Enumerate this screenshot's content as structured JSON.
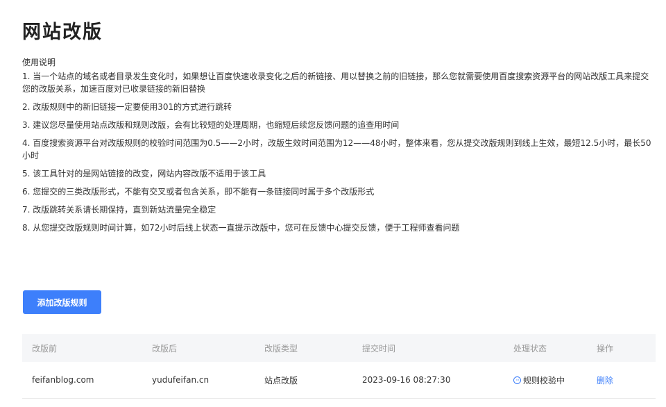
{
  "page": {
    "title": "网站改版"
  },
  "usage": {
    "title": "使用说明",
    "lines": [
      "1. 当一个站点的域名或者目录发生变化时，如果想让百度快速收录变化之后的新链接、用以替换之前的旧链接，那么您就需要使用百度搜索资源平台的网站改版工具来提交您的改版关系，加速百度对已收录链接的新旧替换",
      "2. 改版规则中的新旧链接一定要使用301的方式进行跳转",
      "3. 建议您尽量使用站点改版和规则改版，会有比较短的处理周期，也缩短后续您反馈问题的追查用时间",
      "4. 百度搜索资源平台对改版规则的校验时间范围为0.5——2小时，改版生效时间范围为12——48小时，整体来看，您从提交改版规则到线上生效，最短12.5小时，最长50小时",
      "5. 该工具针对的是网站链接的改变，网站内容改版不适用于该工具",
      "6. 您提交的三类改版形式，不能有交叉或者包含关系，即不能有一条链接同时属于多个改版形式",
      "7. 改版跳转关系请长期保持，直到新站流量完全稳定",
      "8. 从您提交改版规则时间计算，如72小时后线上状态一直提示改版中，您可在反馈中心提交反馈，便于工程师查看问题"
    ]
  },
  "actions": {
    "add_rule_label": "添加改版规则"
  },
  "table": {
    "headers": [
      "改版前",
      "改版后",
      "改版类型",
      "提交时间",
      "处理状态",
      "操作"
    ],
    "rows": [
      {
        "before": "feifanblog.com",
        "after": "yudufeifan.cn",
        "type": "站点改版",
        "submitted": "2023-09-16 08:27:30",
        "status": "规则校验中",
        "status_icon": "ellipsis-circle-icon",
        "action": "删除"
      }
    ]
  },
  "colors": {
    "accent": "#3d7ffb",
    "header_bg": "#f5f6f8"
  }
}
